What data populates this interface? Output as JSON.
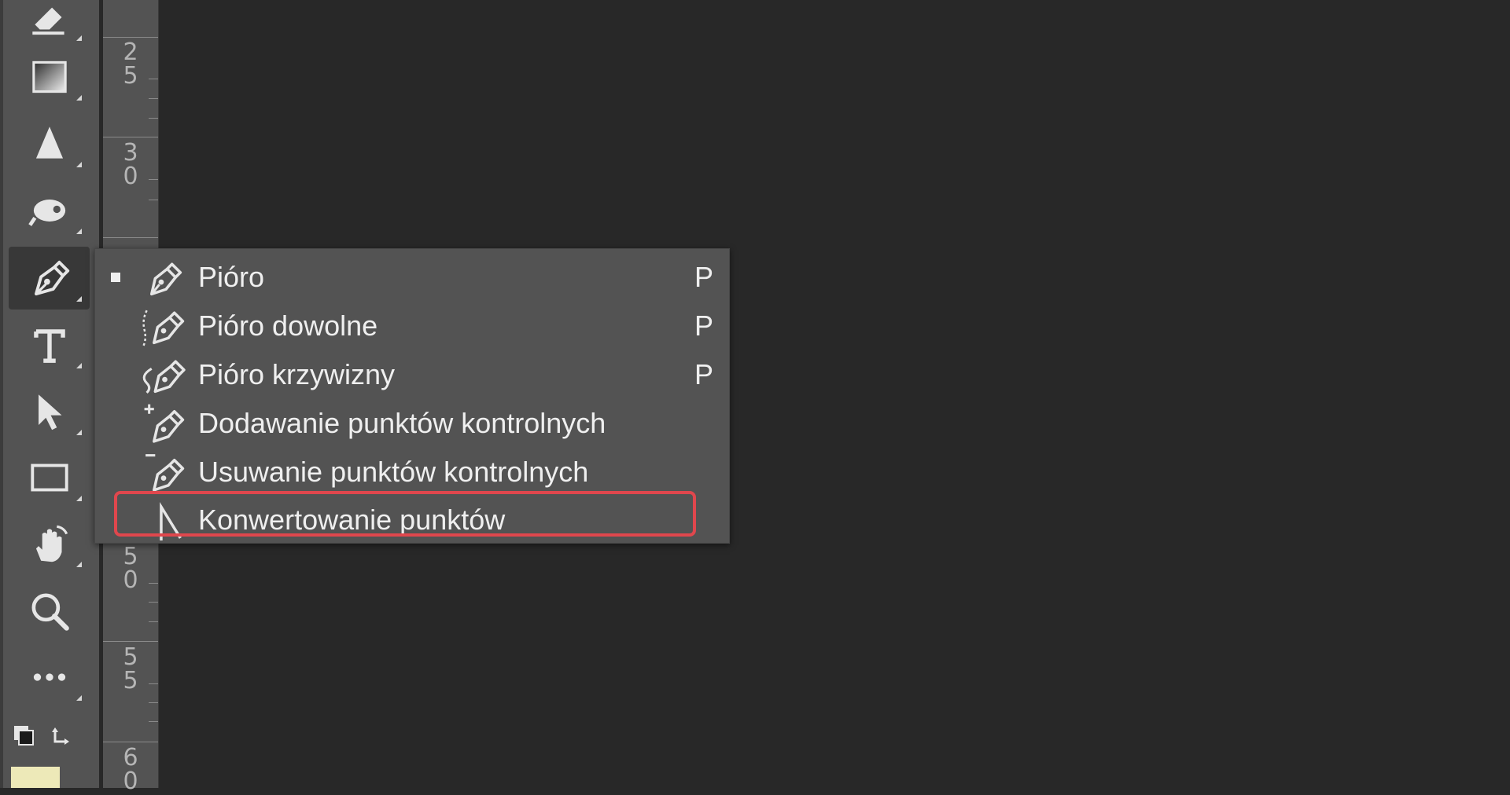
{
  "toolbar": {
    "tools": [
      {
        "icon": "eraser-icon",
        "name": "eraser-tool"
      },
      {
        "icon": "gradient-icon",
        "name": "gradient-tool"
      },
      {
        "icon": "blur-icon",
        "name": "blur-tool"
      },
      {
        "icon": "dodge-icon",
        "name": "dodge-tool"
      },
      {
        "icon": "pen-icon",
        "name": "pen-tool"
      },
      {
        "icon": "type-icon",
        "name": "type-tool"
      },
      {
        "icon": "path-selection-icon",
        "name": "path-selection-tool"
      },
      {
        "icon": "rectangle-icon",
        "name": "rectangle-tool"
      },
      {
        "icon": "hand-icon",
        "name": "hand-tool"
      },
      {
        "icon": "zoom-icon",
        "name": "zoom-tool"
      },
      {
        "icon": "more-icon",
        "name": "edit-toolbar"
      }
    ],
    "active_tool": "pen-tool",
    "foreground_color": "#000000",
    "background_color": "#ede9b8"
  },
  "ruler": {
    "labels": [
      "25",
      "30",
      "50",
      "55",
      "60"
    ]
  },
  "flyout": {
    "items": [
      {
        "label": "Pióro",
        "shortcut": "P",
        "icon": "pen-icon",
        "selected": true
      },
      {
        "label": "Pióro dowolne",
        "shortcut": "P",
        "icon": "freeform-pen-icon",
        "selected": false
      },
      {
        "label": "Pióro krzywizny",
        "shortcut": "P",
        "icon": "curvature-pen-icon",
        "selected": false
      },
      {
        "label": "Dodawanie punktów kontrolnych",
        "shortcut": "",
        "icon": "add-anchor-point-icon",
        "selected": false
      },
      {
        "label": "Usuwanie punktów kontrolnych",
        "shortcut": "",
        "icon": "delete-anchor-point-icon",
        "selected": false
      },
      {
        "label": "Konwertowanie punktów",
        "shortcut": "",
        "icon": "convert-point-icon",
        "selected": false,
        "highlighted": true
      }
    ],
    "highlight_color": "#e0474d"
  }
}
